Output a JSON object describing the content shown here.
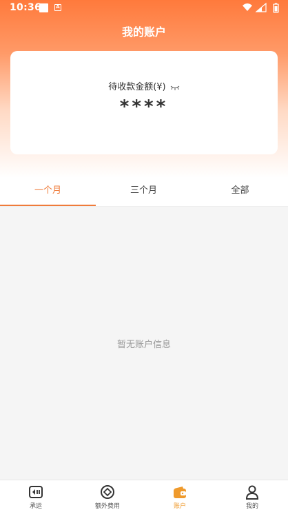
{
  "status_bar": {
    "time": "10:36",
    "a_icon_letter": "A"
  },
  "header": {
    "title": "我的账户"
  },
  "card": {
    "pending_label": "待收款金额(¥)",
    "amount_masked": "****",
    "eye_icon": "eye-closed-icon"
  },
  "tabs": [
    {
      "label": "一个月",
      "active": true
    },
    {
      "label": "三个月",
      "active": false
    },
    {
      "label": "全部",
      "active": false
    }
  ],
  "empty_state": {
    "text": "暂无账户信息"
  },
  "bottom_nav": [
    {
      "label": "承运",
      "icon": "carrier-icon",
      "active": false
    },
    {
      "label": "额外费用",
      "icon": "extra-fee-icon",
      "active": false
    },
    {
      "label": "账户",
      "icon": "wallet-icon",
      "active": true
    },
    {
      "label": "我的",
      "icon": "profile-icon",
      "active": false
    }
  ],
  "colors": {
    "accent": "#ef7b3a",
    "header_top": "#ff7a3c",
    "nav_active": "#ef9a2c"
  }
}
